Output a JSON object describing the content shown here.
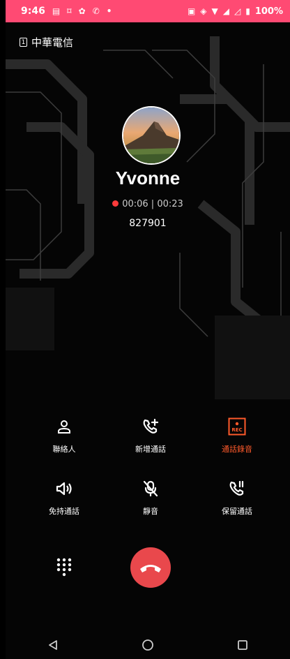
{
  "status_bar": {
    "time": "9:46",
    "battery": "100%"
  },
  "carrier": {
    "sim_slot": "1",
    "name": "中華電信"
  },
  "call": {
    "caller_name": "Yvonne",
    "recording_time": "00:06",
    "call_duration": "00:23",
    "separator": "|",
    "number": "827901"
  },
  "actions": [
    {
      "label": "聯絡人",
      "icon": "contact-icon"
    },
    {
      "label": "新增通話",
      "icon": "add-call-icon"
    },
    {
      "label": "通話錄音",
      "icon": "record-icon",
      "active": true
    },
    {
      "label": "免持通話",
      "icon": "speaker-icon"
    },
    {
      "label": "靜音",
      "icon": "mute-icon"
    },
    {
      "label": "保留通話",
      "icon": "hold-icon"
    }
  ],
  "colors": {
    "status_bar": "#ff4a73",
    "hangup": "#e9484c",
    "active_accent": "#ff5a2b",
    "rec_dot": "#ff3b3b"
  }
}
